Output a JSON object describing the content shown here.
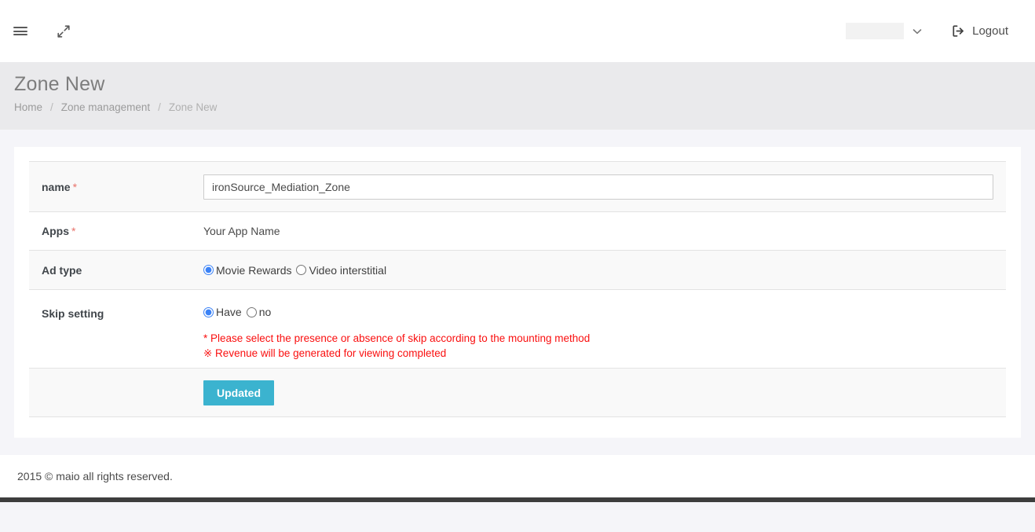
{
  "navbar": {
    "menu_icon": "hamburger-icon",
    "expand_icon": "expand-arrows-icon",
    "user_value": "",
    "caret_icon": "chevron-down-icon",
    "logout_icon": "logout-icon",
    "logout_label": "Logout"
  },
  "header": {
    "title": "Zone New",
    "breadcrumb": {
      "home": "Home",
      "sep1": "/",
      "section": "Zone management",
      "sep2": "/",
      "current": "Zone New"
    }
  },
  "form": {
    "name": {
      "label": "name",
      "required_mark": "*",
      "value": "ironSource_Mediation_Zone",
      "placeholder": ""
    },
    "apps": {
      "label": "Apps",
      "required_mark": "*",
      "value": "Your App Name"
    },
    "ad_type": {
      "label": "Ad type",
      "options": [
        {
          "label": "Movie Rewards",
          "selected": true
        },
        {
          "label": "Video interstitial",
          "selected": false
        }
      ]
    },
    "skip_setting": {
      "label": "Skip setting",
      "options": [
        {
          "label": "Have",
          "selected": true
        },
        {
          "label": "no",
          "selected": false
        }
      ],
      "note1": "* Please select the presence or absence of skip according to the mounting method",
      "note2": "※ Revenue will be generated for viewing completed"
    },
    "submit": {
      "label": "Updated"
    }
  },
  "footer": {
    "copyright": "2015 © maio all rights reserved."
  },
  "colors": {
    "accent_button": "#3bb3cf",
    "radio_selected": "#3b82f6",
    "note_red": "#fa0f0f",
    "required_star": "#e8726a",
    "page_background": "#f5f5f9",
    "header_band": "#eaeaec"
  }
}
